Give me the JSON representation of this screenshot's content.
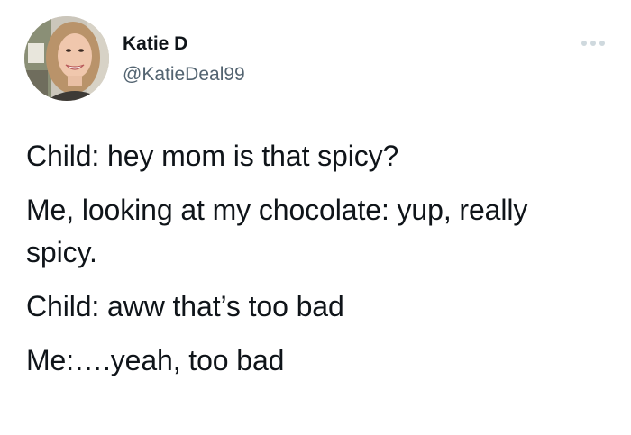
{
  "tweet": {
    "author": {
      "display_name": "Katie D",
      "handle": "@KatieDeal99",
      "avatar_icon": "profile-photo"
    },
    "more_icon": "ellipsis-icon",
    "lines": [
      "Child: hey mom is that spicy?",
      "Me, looking at my chocolate: yup, really spicy.",
      "Child: aww that’s too bad",
      "Me:….yeah, too bad"
    ]
  },
  "colors": {
    "text_primary": "#0f1419",
    "text_secondary": "#536471",
    "background": "#ffffff",
    "more_icon": "#cfd9de"
  }
}
